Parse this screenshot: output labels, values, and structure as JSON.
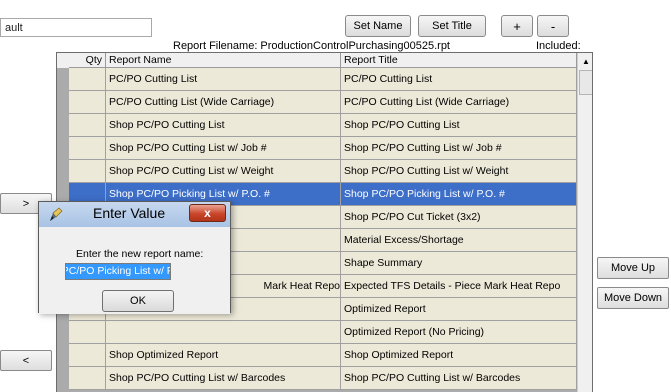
{
  "profile": {
    "value": "ault"
  },
  "toolbar": {
    "set_name": "Set Name",
    "set_title": "Set Title",
    "plus": "+",
    "minus": "-"
  },
  "report_filename_label": "Report Filename: ProductionControlPurchasing00525.rpt",
  "included_label": "Included:",
  "grid": {
    "columns": {
      "qty": "Qty",
      "name": "Report Name",
      "title": "Report Title"
    },
    "rows": [
      {
        "name": "PC/PO Cutting List",
        "title": "PC/PO Cutting List"
      },
      {
        "name": "PC/PO Cutting List (Wide Carriage)",
        "title": "PC/PO Cutting List (Wide Carriage)"
      },
      {
        "name": "Shop PC/PO Cutting List",
        "title": "Shop PC/PO Cutting List"
      },
      {
        "name": "Shop PC/PO Cutting List w/ Job #",
        "title": "Shop PC/PO Cutting List w/ Job #"
      },
      {
        "name": "Shop PC/PO Cutting List w/ Weight",
        "title": "Shop PC/PO Cutting List w/ Weight"
      },
      {
        "name": "Shop PC/PO Picking List w/ P.O. #",
        "title": "Shop PC/PO Picking List w/ P.O. #",
        "selected": true
      },
      {
        "name": "",
        "title": "Shop PC/PO Cut Ticket (3x2)"
      },
      {
        "name": "",
        "title": "Material Excess/Shortage"
      },
      {
        "name": "",
        "title": "Shape Summary"
      },
      {
        "name": "Mark Heat Repo",
        "title": "Expected TFS Details - Piece Mark Heat Repo"
      },
      {
        "name": "",
        "title": "Optimized Report"
      },
      {
        "name": "",
        "title": "Optimized Report (No Pricing)"
      },
      {
        "name": "Shop Optimized Report",
        "title": "Shop Optimized Report"
      },
      {
        "name": "Shop PC/PO Cutting List w/ Barcodes",
        "title": "Shop PC/PO Cutting List w/ Barcodes"
      }
    ]
  },
  "side": {
    "add_arrow": ">",
    "remove_arrow": "<",
    "move_up": "Move Up",
    "move_down": "Move Down"
  },
  "dialog": {
    "title": "Enter Value",
    "close": "x",
    "prompt": "Enter the new report name:",
    "value": "p PC/PO Picking List w/ P.O. #",
    "ok": "OK"
  },
  "icons": {
    "dialog_icon": "pencil-icon",
    "close_icon": "close-icon",
    "scroll_up_icon": "arrow-up-icon"
  }
}
